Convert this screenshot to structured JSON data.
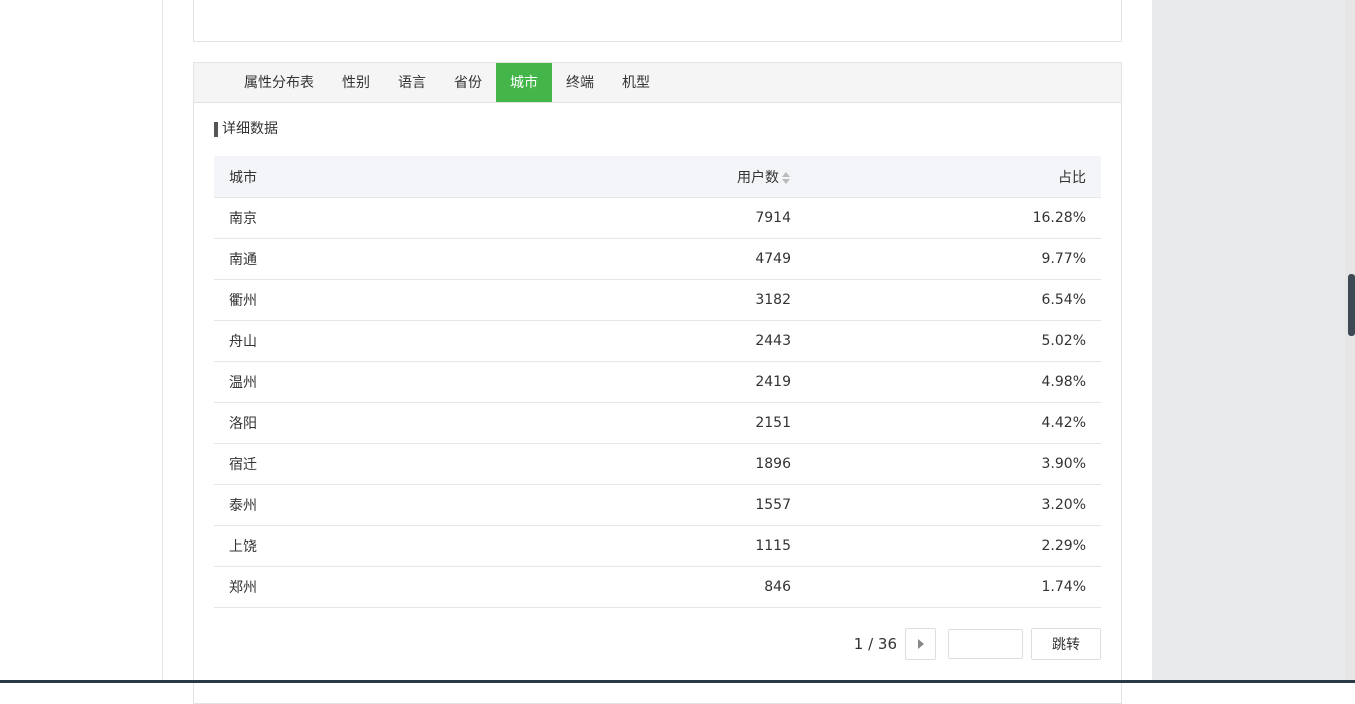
{
  "tabs": [
    {
      "label": "属性分布表",
      "active": false
    },
    {
      "label": "性别",
      "active": false
    },
    {
      "label": "语言",
      "active": false
    },
    {
      "label": "省份",
      "active": false
    },
    {
      "label": "城市",
      "active": true
    },
    {
      "label": "终端",
      "active": false
    },
    {
      "label": "机型",
      "active": false
    }
  ],
  "section_title": "详细数据",
  "table": {
    "headers": {
      "city": "城市",
      "users": "用户数",
      "ratio": "占比"
    },
    "rows": [
      {
        "city": "南京",
        "users": "7914",
        "ratio": "16.28%"
      },
      {
        "city": "南通",
        "users": "4749",
        "ratio": "9.77%"
      },
      {
        "city": "衢州",
        "users": "3182",
        "ratio": "6.54%"
      },
      {
        "city": "舟山",
        "users": "2443",
        "ratio": "5.02%"
      },
      {
        "city": "温州",
        "users": "2419",
        "ratio": "4.98%"
      },
      {
        "city": "洛阳",
        "users": "2151",
        "ratio": "4.42%"
      },
      {
        "city": "宿迁",
        "users": "1896",
        "ratio": "3.90%"
      },
      {
        "city": "泰州",
        "users": "1557",
        "ratio": "3.20%"
      },
      {
        "city": "上饶",
        "users": "1115",
        "ratio": "2.29%"
      },
      {
        "city": "郑州",
        "users": "846",
        "ratio": "1.74%"
      }
    ]
  },
  "pager": {
    "page_text": "1 / 36",
    "jump_label": "跳转",
    "input_value": ""
  },
  "colors": {
    "active_tab": "#44b549",
    "scroll_thumb": "#3d4a55"
  }
}
